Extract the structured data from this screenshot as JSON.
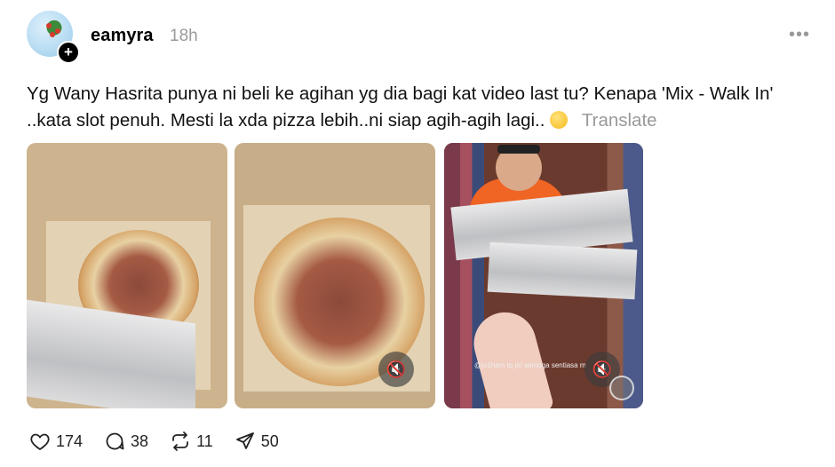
{
  "post": {
    "username": "eamyra",
    "timestamp": "18h",
    "more_label": "•••",
    "follow_label": "+",
    "caption": "Yg Wany Hasrita punya ni beli ke agihan yg dia bagi kat video last tu? Kenapa 'Mix - Walk In' ..kata slot penuh. Mesti la xda pizza lebih..ni siap agih-agih lagi..",
    "emoji": "thinking-face",
    "translate_label": "Translate"
  },
  "media": [
    {
      "type": "image",
      "description_icon": "pizza-box-photo"
    },
    {
      "type": "video",
      "description_icon": "pizza-box-video",
      "mute_icon": "speaker-muted-icon"
    },
    {
      "type": "video",
      "description_icon": "foil-boxes-video",
      "mute_icon": "speaker-muted-icon",
      "overlay_text": "@jo1ham tq jo! semoga sentiasa m"
    }
  ],
  "actions": {
    "likes": "174",
    "comments": "38",
    "reposts": "11",
    "shares": "50"
  },
  "colors": {
    "muted_text": "#999999",
    "text": "#111111",
    "background": "#ffffff"
  }
}
